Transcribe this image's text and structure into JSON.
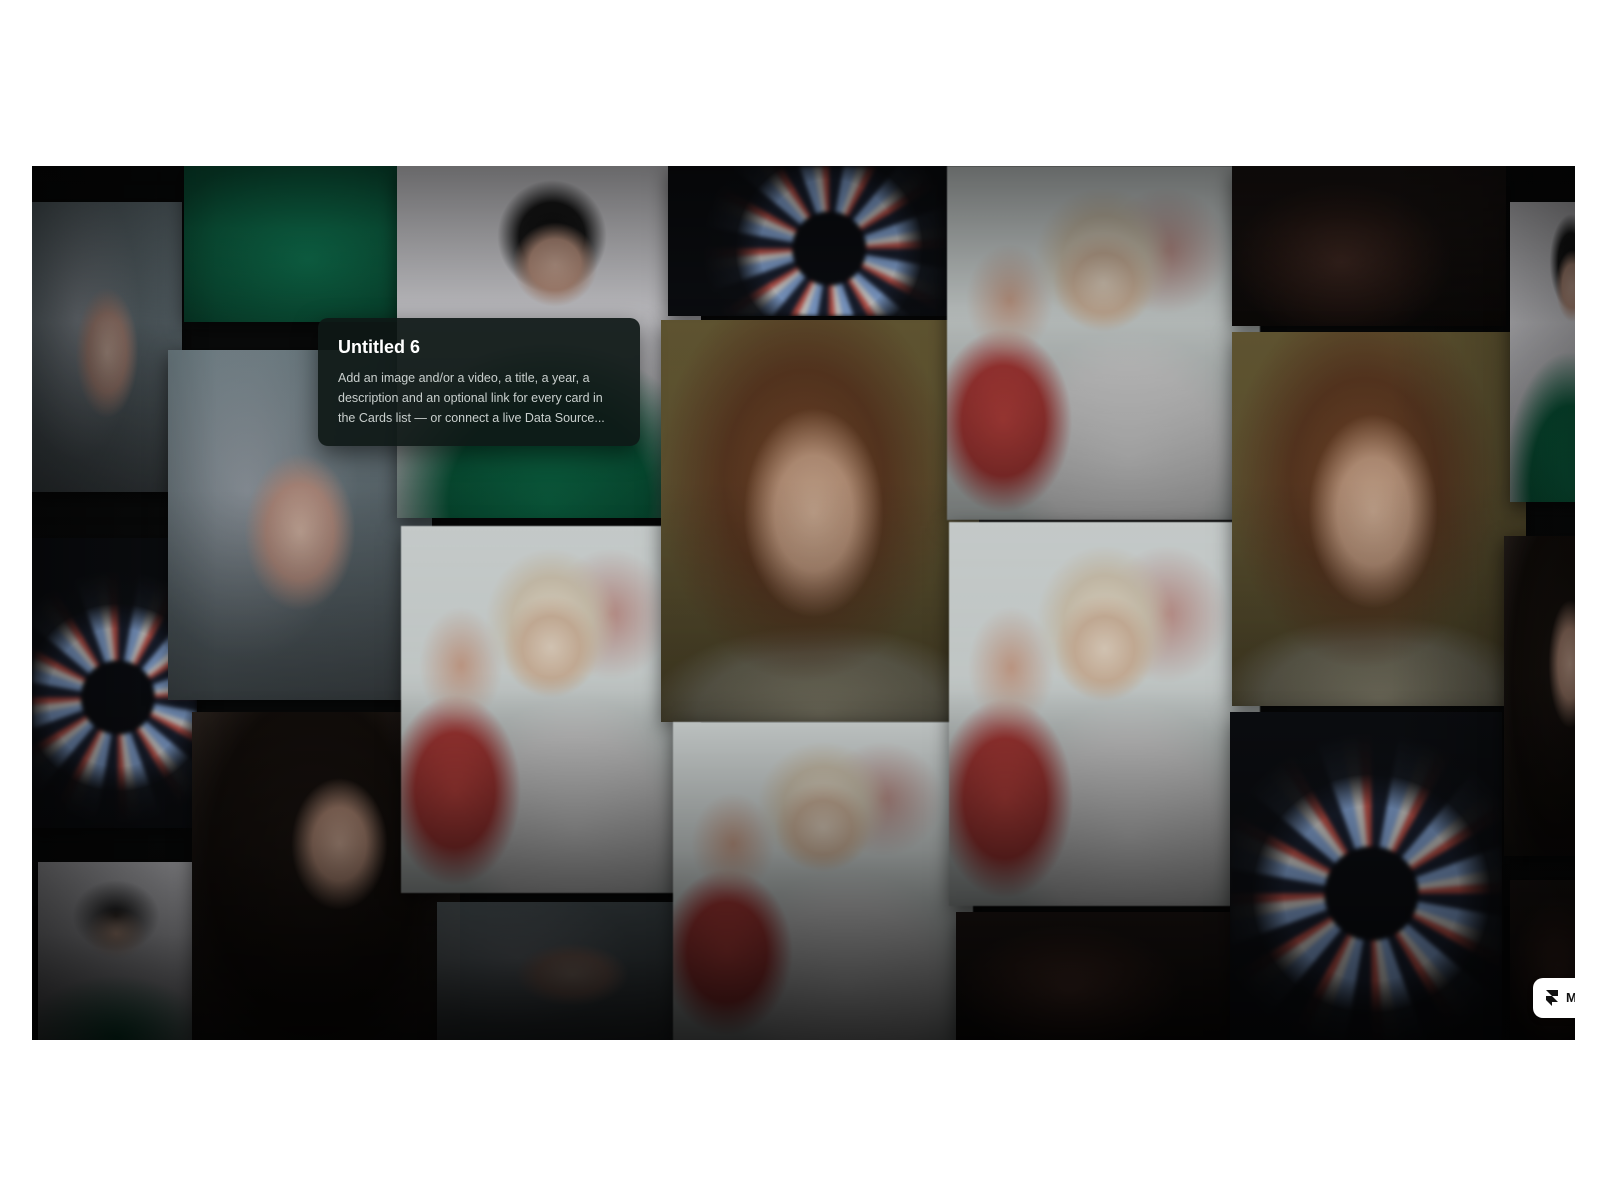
{
  "tooltip": {
    "title": "Untitled 6",
    "description": "Add an image and/or a video, a title, a year, a description and an optional link for every card in the Cards list — or connect a live Data Source..."
  },
  "badge": {
    "icon": "framer-logo-icon",
    "text": "M"
  },
  "colors": {
    "page_background": "#ffffff",
    "stage_background": "#0b0c0c",
    "tooltip_background": "#0e1816",
    "tooltip_title": "#ffffff",
    "tooltip_text": "#c9cfcd"
  }
}
